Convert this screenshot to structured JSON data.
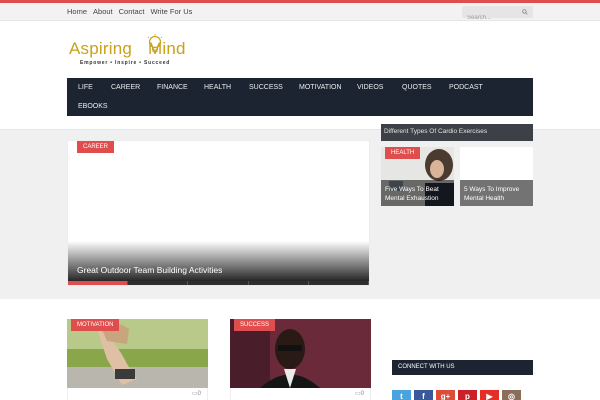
{
  "topbar": {
    "nav": [
      "Home",
      "About",
      "Contact",
      "Write For Us"
    ],
    "search_placeholder": "Search..."
  },
  "logo": {
    "word1": "Aspiring",
    "word2": "Mind",
    "tagline": "Empower • Inspire • Succeed"
  },
  "mainnav": [
    "LIFE",
    "CAREER",
    "FINANCE",
    "HEALTH",
    "SUCCESS",
    "MOTIVATION",
    "VIDEOS",
    "QUOTES",
    "PODCAST",
    "EBOOKS"
  ],
  "featured": {
    "category": "CAREER",
    "title": "Great Outdoor Team Building Activities",
    "slides": 5,
    "active_slide": 1
  },
  "side": {
    "strip_title": "Different Types Of Cardio Exercises",
    "category": "HEALTH",
    "cards": [
      {
        "title": "Five Ways To Beat Mental Exhaustion"
      },
      {
        "title": "5 Ways To Improve Mental Health"
      }
    ]
  },
  "cards": [
    {
      "category": "MOTIVATION",
      "comments": "0"
    },
    {
      "category": "SUCCESS",
      "comments": "0"
    }
  ],
  "widget": {
    "connect_title": "CONNECT WITH US",
    "social": [
      {
        "icon": "twitter-icon",
        "glyph": "t",
        "color": "#4aa3df"
      },
      {
        "icon": "facebook-icon",
        "glyph": "f",
        "color": "#3b5998"
      },
      {
        "icon": "google-plus-icon",
        "glyph": "g+",
        "color": "#dd4b39"
      },
      {
        "icon": "pinterest-icon",
        "glyph": "p",
        "color": "#cb2027"
      },
      {
        "icon": "youtube-icon",
        "glyph": "▶",
        "color": "#e52d27"
      },
      {
        "icon": "instagram-icon",
        "glyph": "◎",
        "color": "#8a6e5a"
      }
    ]
  },
  "colors": {
    "accent": "#e04d4d",
    "nav_bg": "#1b2430",
    "logo_gold": "#c9a11a"
  }
}
